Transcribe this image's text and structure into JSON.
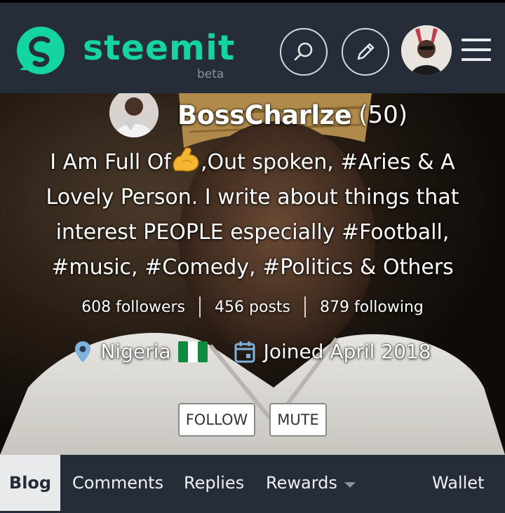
{
  "header": {
    "brand": "steemit",
    "beta_label": "beta",
    "icons": {
      "logo": "steemit-logo-icon",
      "search": "search-icon",
      "edit": "pencil-icon",
      "menu": "hamburger-icon"
    },
    "colors": {
      "bar": "#252e38",
      "brand": "#14d4a3"
    }
  },
  "profile": {
    "username": "BossCharlze",
    "reputation": "(50)",
    "about_part1": "I Am Full Of",
    "about_emoji": "flexed-biceps",
    "about_part2": ",Out spoken, #Aries & A Lovely Person. I write about things that interest PEOPLE especially #Football, #music, #Comedy, #Politics & Others",
    "stats": {
      "followers": "608 followers",
      "posts": "456 posts",
      "following": "879 following"
    },
    "location": "Nigeria",
    "location_icon": "location-pin-icon",
    "flag_icon": "nigeria-flag-icon",
    "joined": "Joined April 2018",
    "joined_icon": "calendar-icon"
  },
  "actions": {
    "follow_label": "FOLLOW",
    "mute_label": "MUTE"
  },
  "tabs": [
    {
      "label": "Blog",
      "active": true
    },
    {
      "label": "Comments",
      "active": false
    },
    {
      "label": "Replies",
      "active": false
    },
    {
      "label": "Rewards",
      "active": false
    },
    {
      "label": "Wallet",
      "active": false
    }
  ]
}
